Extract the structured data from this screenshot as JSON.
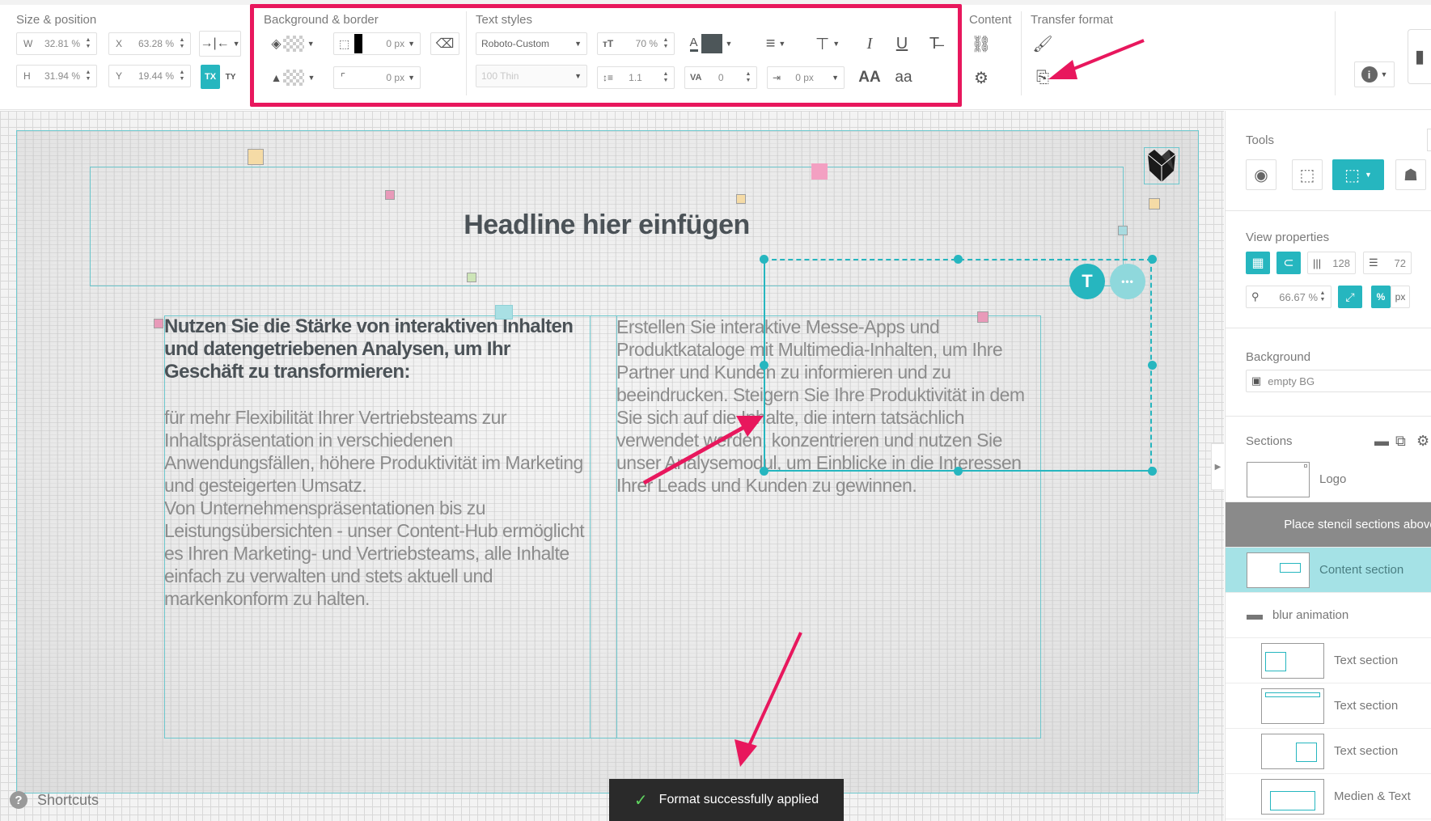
{
  "toolbar": {
    "size_position": {
      "label": "Size & position",
      "w_label": "W",
      "w_value": "32.81 %",
      "x_label": "X",
      "x_value": "63.28 %",
      "h_label": "H",
      "h_value": "31.94 %",
      "y_label": "Y",
      "y_value": "19.44 %"
    },
    "background_border": {
      "label": "Background & border",
      "border_width": "0 px",
      "radius": "0 px"
    },
    "text_styles": {
      "label": "Text styles",
      "font_family": "Roboto-Custom",
      "font_weight": "100 Thin",
      "font_size": "70 %",
      "line_height": "1.1",
      "letter_spacing": "0",
      "indent": "0 px",
      "text_color": "#4d5659",
      "italic_glyph": "I",
      "underline_glyph": "U",
      "case_upper_glyph": "AA",
      "case_lower_glyph": "aa"
    },
    "content": {
      "label": "Content"
    },
    "transfer_format": {
      "label": "Transfer format"
    }
  },
  "canvas": {
    "headline": "Headline hier einfügen",
    "col1_heading": "Nutzen Sie die Stärke von interaktiven Inhalten und datengetriebenen Analysen, um Ihr Geschäft zu transformieren:",
    "col1_body": "für mehr Flexibilität Ihrer Vertriebsteams zur Inhaltspräsentation in verschiedenen Anwendungsfällen, höhere Produktivität im Marketing und gesteigerten Umsatz.\nVon Unternehmenspräsentationen bis zu Leistungsübersichten - unser Content-Hub ermöglicht es Ihren Marketing- und Vertriebsteams, alle Inhalte einfach zu verwalten und stets aktuell und markenkonform zu halten.",
    "col2_body": "Erstellen Sie interaktive Messe-Apps und Produktkataloge mit Multimedia-Inhalten, um Ihre Partner und Kunden zu informieren und zu beeindrucken. Steigern Sie Ihre Produktivität in dem Sie sich auf die Inhalte, die intern tatsächlich verwendet werden, konzentrieren und nutzen Sie unser Analysemodul, um Einblicke in die Interessen Ihrer Leads und Kunden zu gewinnen.",
    "text_btn_label": "T",
    "more_btn_label": "•••",
    "shortcuts_label": "Shortcuts",
    "toast_message": "Format successfully applied",
    "accent_color": "#26b6bf",
    "annotation_color": "#e8175d"
  },
  "panel": {
    "tools_label": "Tools",
    "view_properties_label": "View properties",
    "grid_columns": "128",
    "grid_rows": "72",
    "zoom_value": "66.67 %",
    "unit_pct": "%",
    "unit_px": "px",
    "background_label": "Background",
    "background_value": "empty BG",
    "sections_label": "Sections",
    "sections": [
      {
        "label": "Logo"
      },
      {
        "label": "Place stencil sections above"
      },
      {
        "label": "Content section"
      },
      {
        "label": "blur animation"
      },
      {
        "label": "Text section"
      },
      {
        "label": "Text section"
      },
      {
        "label": "Text section"
      },
      {
        "label": "Medien & Text"
      }
    ]
  }
}
